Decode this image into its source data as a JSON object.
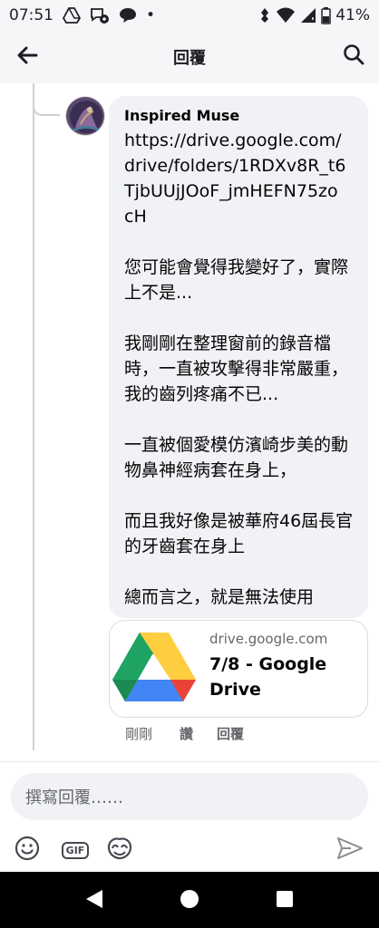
{
  "status_bar": {
    "time": "07:51",
    "dot": "•",
    "battery": "41%",
    "left_icons": [
      "drive-icon",
      "messenger-icon",
      "chat-bubble-icon"
    ],
    "right_icons": [
      "vibrate-icon",
      "wifi-icon",
      "signal-icon",
      "battery-icon"
    ]
  },
  "header": {
    "title": "回覆",
    "back_icon": "arrow-left-icon",
    "search_icon": "search-icon"
  },
  "comment": {
    "author": "Inspired Muse",
    "link": "https://drive.google.com/drive/folders/1RDXv8R_t6TjbUUjJOoF_jmHEFN75zocH",
    "paragraphs": [
      "您可能會覺得我變好了，實際上不是...",
      "我剛剛在整理窗前的錄音檔時，一直被攻擊得非常嚴重，我的齒列疼痛不已...",
      "一直被個愛模仿濱崎步美的動物鼻神經病套在身上，",
      "而且我好像是被華府46屆長官的牙齒套在身上",
      "總而言之，就是無法使用"
    ]
  },
  "link_preview": {
    "domain": "drive.google.com",
    "title": "7/8 - Google Drive",
    "colors": {
      "green": "#1fa463",
      "blue": "#4285f4",
      "yellow": "#ffcd40",
      "red": "#ea4335"
    }
  },
  "actions": {
    "time": "剛剛",
    "like": "讚",
    "reply": "回覆"
  },
  "reply_box": {
    "placeholder": "撰寫回覆……"
  },
  "toolbar": {
    "emoji_icon": "smiley-icon",
    "gif_label": "GIF",
    "sticker_icon": "sticker-icon",
    "send_icon": "send-icon"
  },
  "theme": {
    "bubble_bg": "#f0f2f5",
    "secondary_text": "#65676b",
    "thread_line": "#ced0d4"
  }
}
